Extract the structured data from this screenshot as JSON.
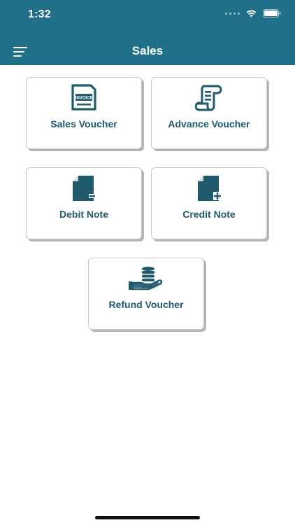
{
  "status": {
    "time": "1:32"
  },
  "header": {
    "title": "Sales"
  },
  "cards": {
    "sales_voucher": {
      "label": "Sales Voucher",
      "icon_text": "INVOICE"
    },
    "advance_voucher": {
      "label": "Advance Voucher"
    },
    "debit_note": {
      "label": "Debit Note"
    },
    "credit_note": {
      "label": "Credit Note"
    },
    "refund_voucher": {
      "label": "Refund Voucher"
    }
  },
  "colors": {
    "header": "#1f7088",
    "icon": "#1f5a6d",
    "label": "#1f5a6d"
  }
}
